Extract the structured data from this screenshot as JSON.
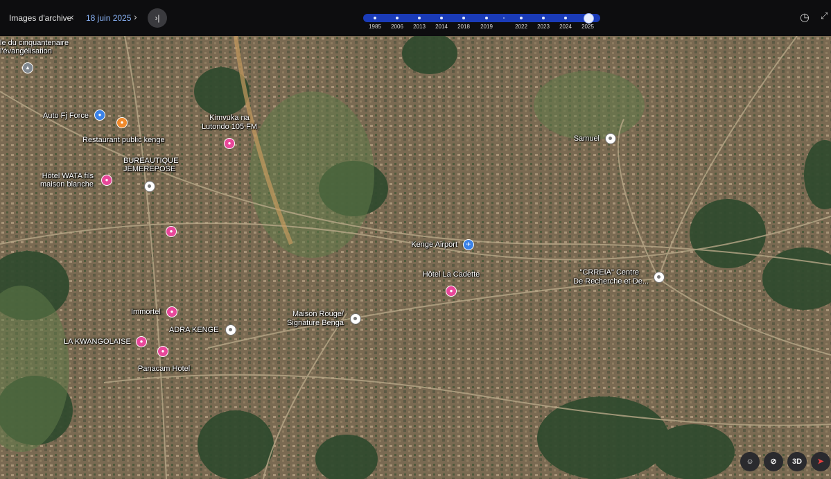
{
  "topbar": {
    "archive_label": "Images d'archive",
    "prev_icon": "chevron-left-icon",
    "date": "18 juin 2025",
    "next_icon": "chevron-right-icon",
    "end_icon": "skip-to-end-icon",
    "timeline_years": [
      "1985",
      "2006",
      "2013",
      "2014",
      "2018",
      "2019",
      "2022",
      "2023",
      "2024",
      "2025"
    ],
    "timeline_selected": "2025",
    "timeline_color": "#1a3bb8"
  },
  "map": {
    "labels": [
      {
        "id": "cinquantenaire",
        "text": "le du cinquantenaire"
      },
      {
        "id": "evangelisation",
        "text": "l'évangélisation"
      },
      {
        "id": "auto-fj-force",
        "text": "Auto Fj Force"
      },
      {
        "id": "restaurant-public",
        "text": "Restaurant public kenge"
      },
      {
        "id": "kimvuka-1",
        "text": "Kimvuka na"
      },
      {
        "id": "kimvuka-2",
        "text": "Lutondo 105 FM"
      },
      {
        "id": "bureautique-1",
        "text": "BUREAUTIQUE"
      },
      {
        "id": "bureautique-2",
        "text": "JEMEREPOSE"
      },
      {
        "id": "hotel-wata-1",
        "text": "Hôtel WATA fils"
      },
      {
        "id": "hotel-wata-2",
        "text": "maison blanche"
      },
      {
        "id": "samuel",
        "text": "Samuel"
      },
      {
        "id": "kenge-airport",
        "text": "Kenge Airport"
      },
      {
        "id": "crreia-1",
        "text": "\"CRREIA\" Centre"
      },
      {
        "id": "crreia-2",
        "text": "De Recherche et De..."
      },
      {
        "id": "hotel-cadette",
        "text": "Hôtel La Cadette"
      },
      {
        "id": "immortel",
        "text": "Immortel"
      },
      {
        "id": "maison-rouge-1",
        "text": "Maison Rouge/"
      },
      {
        "id": "maison-rouge-2",
        "text": "Signature Benga"
      },
      {
        "id": "adra-kenge",
        "text": "ADRA KENGE"
      },
      {
        "id": "kwangolaise",
        "text": "LA KWANGOLAISE"
      },
      {
        "id": "panacam",
        "text": "Panacam Hotel"
      }
    ]
  },
  "controls": {
    "pegman_icon": "pegman-icon",
    "tilt_icon": "no-tilt-icon",
    "label_3d": "3D",
    "compass_icon": "compass-icon",
    "history_icon": "history-icon",
    "fullscreen_icon": "fullscreen-icon"
  }
}
